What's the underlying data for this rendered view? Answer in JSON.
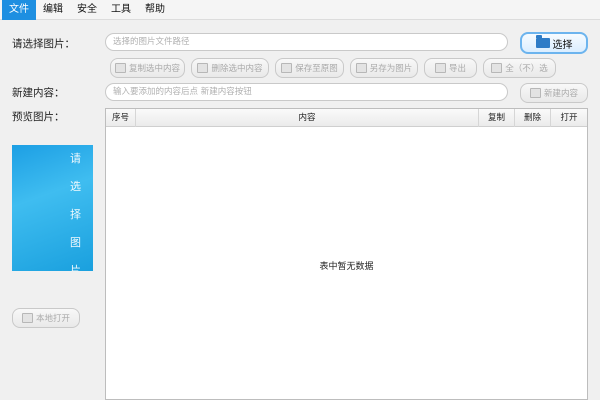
{
  "menu": {
    "items": [
      {
        "label": "文件",
        "active": true
      },
      {
        "label": "编辑",
        "active": false
      },
      {
        "label": "安全",
        "active": false
      },
      {
        "label": "工具",
        "active": false
      },
      {
        "label": "帮助",
        "active": false
      }
    ]
  },
  "select_image": {
    "label": "请选择图片：",
    "placeholder": "选择的图片文件路径",
    "button_label": "选择"
  },
  "toolbar": {
    "copy_selected": "复制选中内容",
    "delete_selected": "删除选中内容",
    "save_all": "保存至原图",
    "save_as": "另存为图片",
    "export": "导出",
    "select_all": "全（不）选"
  },
  "new_content": {
    "label": "新建内容：",
    "placeholder": "输入要添加的内容后点 新建内容按钮",
    "button_label": "新建内容"
  },
  "preview": {
    "label": "预览图片：",
    "image_text": "请选择图片",
    "local_open_label": "本地打开"
  },
  "table": {
    "columns": [
      "序号",
      "内容",
      "复制",
      "删除",
      "打开"
    ],
    "empty_text": "表中暂无数据",
    "rows": []
  },
  "colors": {
    "accent": "#1e8fe1",
    "preview_bg": "#2aa9e8"
  }
}
